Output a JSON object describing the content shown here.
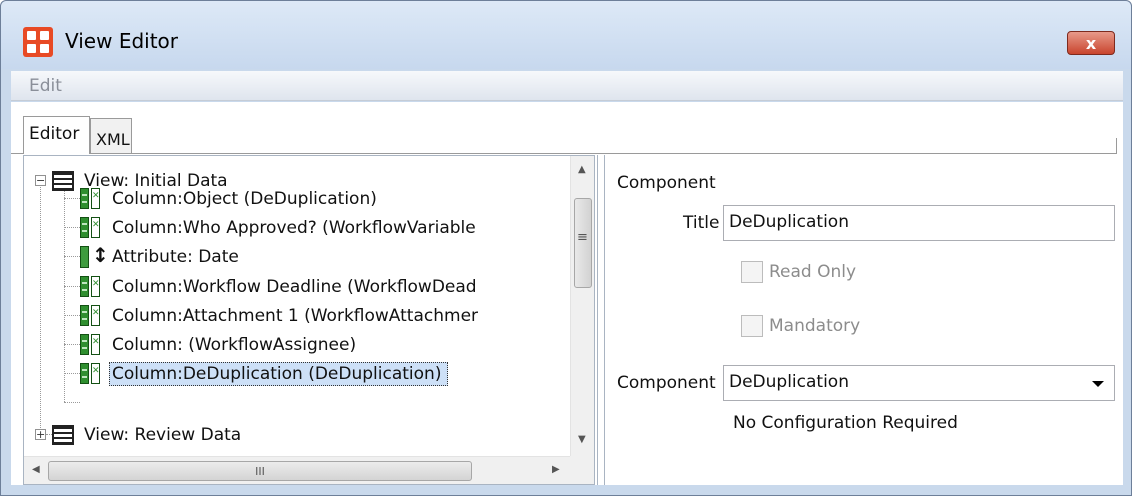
{
  "window": {
    "title": "View Editor",
    "close_label": "x",
    "colors": {
      "accent": "#e84a25",
      "selection": "#cde0f7",
      "frame": "#c9d9ec"
    }
  },
  "menu": {
    "edit_label": "Edit"
  },
  "tabs": [
    {
      "label": "Editor",
      "active": true
    },
    {
      "label": "XML",
      "active": false
    }
  ],
  "tree": {
    "nodes": [
      {
        "label": "View: Initial Data",
        "icon": "view-icon",
        "expanded": true
      },
      {
        "label": "Column:Object (DeDuplication)",
        "icon": "column-icon"
      },
      {
        "label": "Column:Who Approved? (WorkflowVariable",
        "icon": "column-icon"
      },
      {
        "label": "Attribute: Date",
        "icon": "attribute-icon"
      },
      {
        "label": "Column:Workflow Deadline (WorkflowDead",
        "icon": "column-icon"
      },
      {
        "label": "Column:Attachment 1 (WorkflowAttachmer",
        "icon": "column-icon"
      },
      {
        "label": "Column: (WorkflowAssignee)",
        "icon": "column-icon"
      },
      {
        "label": "Column:DeDuplication (DeDuplication)",
        "icon": "column-icon",
        "selected": true
      },
      {
        "label": "View: Review Data",
        "icon": "view-icon",
        "expanded": false
      }
    ],
    "scroll_up": "▲",
    "scroll_down": "▼",
    "scroll_left": "◀",
    "scroll_right": "▶",
    "hthumb_grip": "III",
    "vthumb_grip": "≡"
  },
  "properties": {
    "section_label": "Component",
    "title_label": "Title",
    "title_value": "DeDuplication",
    "read_only_label": "Read Only",
    "read_only_checked": false,
    "mandatory_label": "Mandatory",
    "mandatory_checked": false,
    "component_label": "Component",
    "component_value": "DeDuplication",
    "config_note": "No Configuration Required"
  }
}
